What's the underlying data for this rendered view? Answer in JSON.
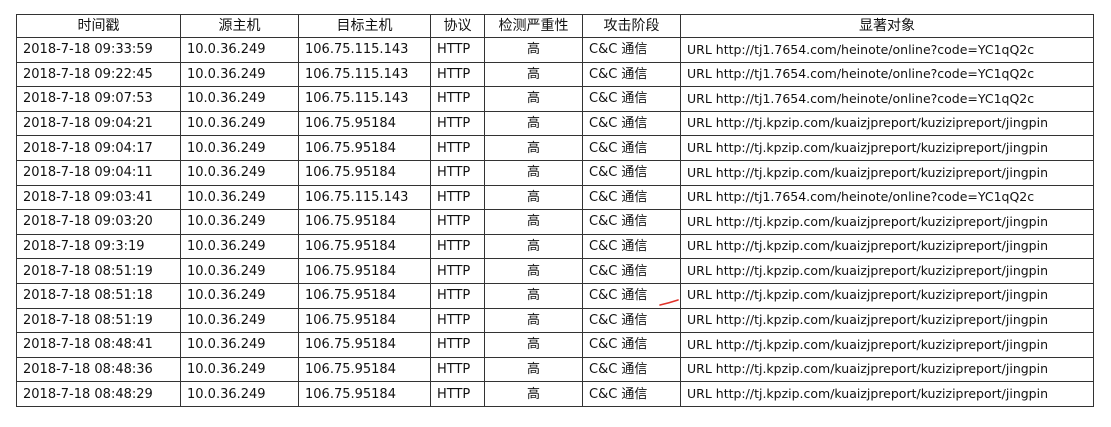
{
  "table": {
    "headers": [
      "时间戳",
      "源主机",
      "目标主机",
      "协议",
      "检测严重性",
      "攻击阶段",
      "显著对象"
    ],
    "rows": [
      [
        "2018-7-18 09:33:59",
        "10.0.36.249",
        "106.75.115.143",
        "HTTP",
        "高",
        "C&C 通信",
        "URL http://tj1.7654.com/heinote/online?code=YC1qQ2c"
      ],
      [
        "2018-7-18 09:22:45",
        "10.0.36.249",
        "106.75.115.143",
        "HTTP",
        "高",
        "C&C 通信",
        "URL http://tj1.7654.com/heinote/online?code=YC1qQ2c"
      ],
      [
        "2018-7-18 09:07:53",
        "10.0.36.249",
        "106.75.115.143",
        "HTTP",
        "高",
        "C&C 通信",
        "URL http://tj1.7654.com/heinote/online?code=YC1qQ2c"
      ],
      [
        "2018-7-18 09:04:21",
        "10.0.36.249",
        "106.75.95184",
        "HTTP",
        "高",
        "C&C 通信",
        "URL http://tj.kpzip.com/kuaizjpreport/kuzizipreport/jingpin"
      ],
      [
        "2018-7-18 09:04:17",
        "10.0.36.249",
        "106.75.95184",
        "HTTP",
        "高",
        "C&C 通信",
        "URL http://tj.kpzip.com/kuaizjpreport/kuzizipreport/jingpin"
      ],
      [
        "2018-7-18 09:04:11",
        "10.0.36.249",
        "106.75.95184",
        "HTTP",
        "高",
        "C&C 通信",
        "URL http://tj.kpzip.com/kuaizjpreport/kuzizipreport/jingpin"
      ],
      [
        "2018-7-18 09:03:41",
        "10.0.36.249",
        "106.75.115.143",
        "HTTP",
        "高",
        "C&C 通信",
        "URL http://tj1.7654.com/heinote/online?code=YC1qQ2c"
      ],
      [
        "2018-7-18 09:03:20",
        "10.0.36.249",
        "106.75.95184",
        "HTTP",
        "高",
        "C&C 通信",
        "URL http://tj.kpzip.com/kuaizjpreport/kuzizipreport/jingpin"
      ],
      [
        "2018-7-18 09:3:19",
        "10.0.36.249",
        "106.75.95184",
        "HTTP",
        "高",
        "C&C 通信",
        "URL http://tj.kpzip.com/kuaizjpreport/kuzizipreport/jingpin"
      ],
      [
        "2018-7-18 08:51:19",
        "10.0.36.249",
        "106.75.95184",
        "HTTP",
        "高",
        "C&C 通信",
        "URL http://tj.kpzip.com/kuaizjpreport/kuzizipreport/jingpin"
      ],
      [
        "2018-7-18 08:51:18",
        "10.0.36.249",
        "106.75.95184",
        "HTTP",
        "高",
        "C&C 通信",
        "URL http://tj.kpzip.com/kuaizjpreport/kuzizipreport/jingpin"
      ],
      [
        "2018-7-18 08:51:19",
        "10.0.36.249",
        "106.75.95184",
        "HTTP",
        "高",
        "C&C 通信",
        "URL http://tj.kpzip.com/kuaizjpreport/kuzizipreport/jingpin"
      ],
      [
        "2018-7-18 08:48:41",
        "10.0.36.249",
        "106.75.95184",
        "HTTP",
        "高",
        "C&C 通信",
        "URL http://tj.kpzip.com/kuaizjpreport/kuzizipreport/jingpin"
      ],
      [
        "2018-7-18 08:48:36",
        "10.0.36.249",
        "106.75.95184",
        "HTTP",
        "高",
        "C&C 通信",
        "URL http://tj.kpzip.com/kuaizjpreport/kuzizipreport/jingpin"
      ],
      [
        "2018-7-18 08:48:29",
        "10.0.36.249",
        "106.75.95184",
        "HTTP",
        "高",
        "C&C 通信",
        "URL http://tj.kpzip.com/kuaizjpreport/kuzizipreport/jingpin"
      ]
    ]
  },
  "colors": {
    "border": "#333333",
    "text": "#111111",
    "annotation_mark": "#e0332b"
  }
}
